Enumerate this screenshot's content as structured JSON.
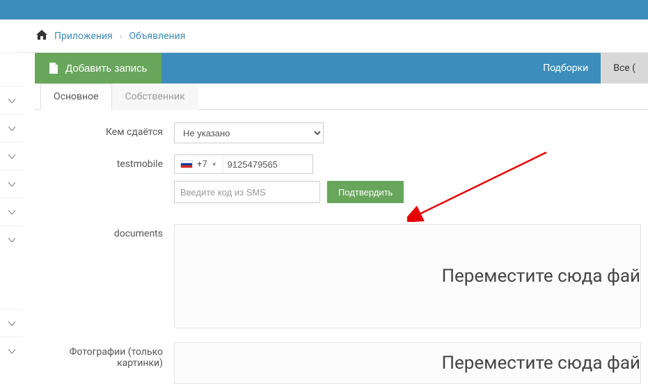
{
  "breadcrumb": {
    "items": [
      "Приложения",
      "Объявления"
    ]
  },
  "header": {
    "add_label": "Добавить запись",
    "link_selections": "Подборки",
    "link_all": "Все ("
  },
  "tabs": {
    "main": "Основное",
    "owner": "Собственник"
  },
  "form": {
    "rented_by": {
      "label": "Кем сдаётся",
      "value": "Не указано"
    },
    "testmobile": {
      "label": "testmobile",
      "prefix": "+7",
      "value": "9125479565"
    },
    "sms": {
      "placeholder": "Введите код из SMS",
      "confirm": "Подтвердить"
    },
    "documents": {
      "label": "documents",
      "dropzone": "Переместите сюда фай"
    },
    "photos": {
      "label": "Фотографии (только картинки)",
      "dropzone": "Переместите сюда фай"
    }
  }
}
